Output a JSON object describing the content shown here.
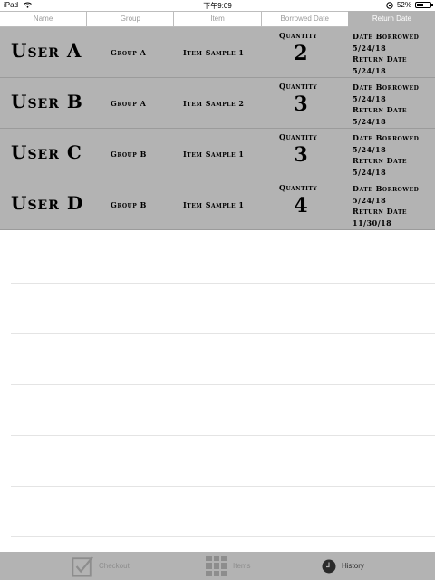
{
  "status": {
    "device": "iPad",
    "time": "下午9:09",
    "battery": "52%",
    "battery_level": 0.52
  },
  "tabs": [
    {
      "label": "Name",
      "active": false
    },
    {
      "label": "Group",
      "active": false
    },
    {
      "label": "Item",
      "active": false
    },
    {
      "label": "Borrowed Date",
      "active": false
    },
    {
      "label": "Return Date",
      "active": true
    }
  ],
  "rows": [
    {
      "user": "User A",
      "group": "Group A",
      "item": "Item Sample 1",
      "quantity_label": "Quantity",
      "quantity": "2",
      "date_borrowed_label": "Date Borrowed",
      "date_borrowed": "5/24/18",
      "return_date_label": "Return Date",
      "return_date": "5/24/18"
    },
    {
      "user": "User B",
      "group": "Group A",
      "item": "Item Sample 2",
      "quantity_label": "Quantity",
      "quantity": "3",
      "date_borrowed_label": "Date Borrowed",
      "date_borrowed": "5/24/18",
      "return_date_label": "Return Date",
      "return_date": "5/24/18"
    },
    {
      "user": "User C",
      "group": "Group B",
      "item": "Item Sample 1",
      "quantity_label": "Quantity",
      "quantity": "3",
      "date_borrowed_label": "Date Borrowed",
      "date_borrowed": "5/24/18",
      "return_date_label": "Return Date",
      "return_date": "5/24/18"
    },
    {
      "user": "User D",
      "group": "Group B",
      "item": "Item Sample 1",
      "quantity_label": "Quantity",
      "quantity": "4",
      "date_borrowed_label": "Date Borrowed",
      "date_borrowed": "5/24/18",
      "return_date_label": "Return Date",
      "return_date": "11/30/18"
    }
  ],
  "bottom_tabs": [
    {
      "label": "Checkout",
      "icon": "checkbox-icon",
      "active": false
    },
    {
      "label": "Items",
      "icon": "grid-icon",
      "active": false
    },
    {
      "label": "History",
      "icon": "clock-icon",
      "active": true
    }
  ],
  "colors": {
    "row_background": "#b3b3b3",
    "tab_active_background": "#b3b3b3",
    "bottom_bar": "#b3b3b3"
  }
}
